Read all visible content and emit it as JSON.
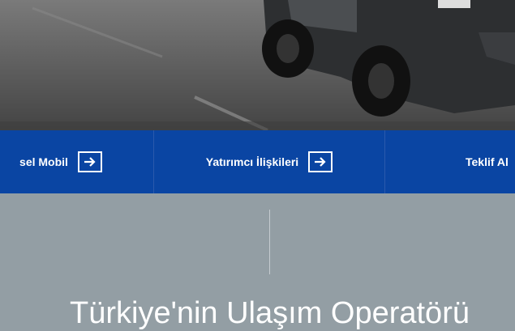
{
  "nav": {
    "items": [
      {
        "label": "sel Mobil"
      },
      {
        "label": "Yatırımcı İlişkileri"
      },
      {
        "label": "Teklif Al"
      }
    ]
  },
  "section": {
    "title": "Türkiye'nin Ulaşım Operatörü"
  },
  "colors": {
    "nav_bg": "#0a45a3",
    "section_bg": "#939ea4"
  }
}
